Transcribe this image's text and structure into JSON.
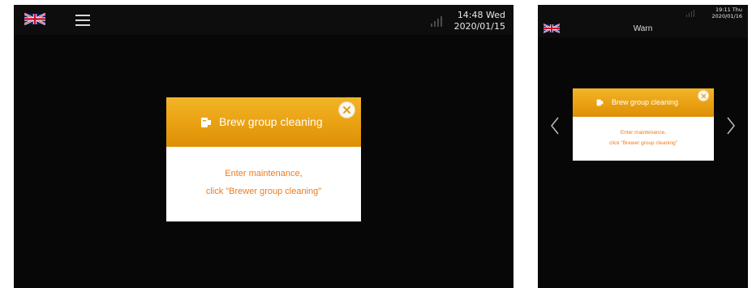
{
  "left_screen": {
    "datetime": {
      "time_day": "14:48 Wed",
      "date": "2020/01/15"
    },
    "dialog": {
      "title": "Brew group cleaning",
      "message_line1": "Enter maintenance,",
      "message_line2": "click \"Brewer group cleaning\""
    }
  },
  "right_screen": {
    "header_title": "Warn",
    "datetime": {
      "time_day": "19:11 Thu",
      "date": "2020/01/16"
    },
    "dialog": {
      "title": "Brew group cleaning",
      "message_line1": "Enter maintenance,",
      "message_line2": "click \"Brewer group cleaning\""
    }
  },
  "icons": [
    "uk-flag-icon",
    "menu-icon",
    "signal-icon",
    "brew-group-icon",
    "close-icon",
    "chevron-left-icon",
    "chevron-right-icon"
  ],
  "colors": {
    "background": "#070707",
    "header_orange": "#e9a012",
    "message_orange": "#ed7b1c"
  }
}
